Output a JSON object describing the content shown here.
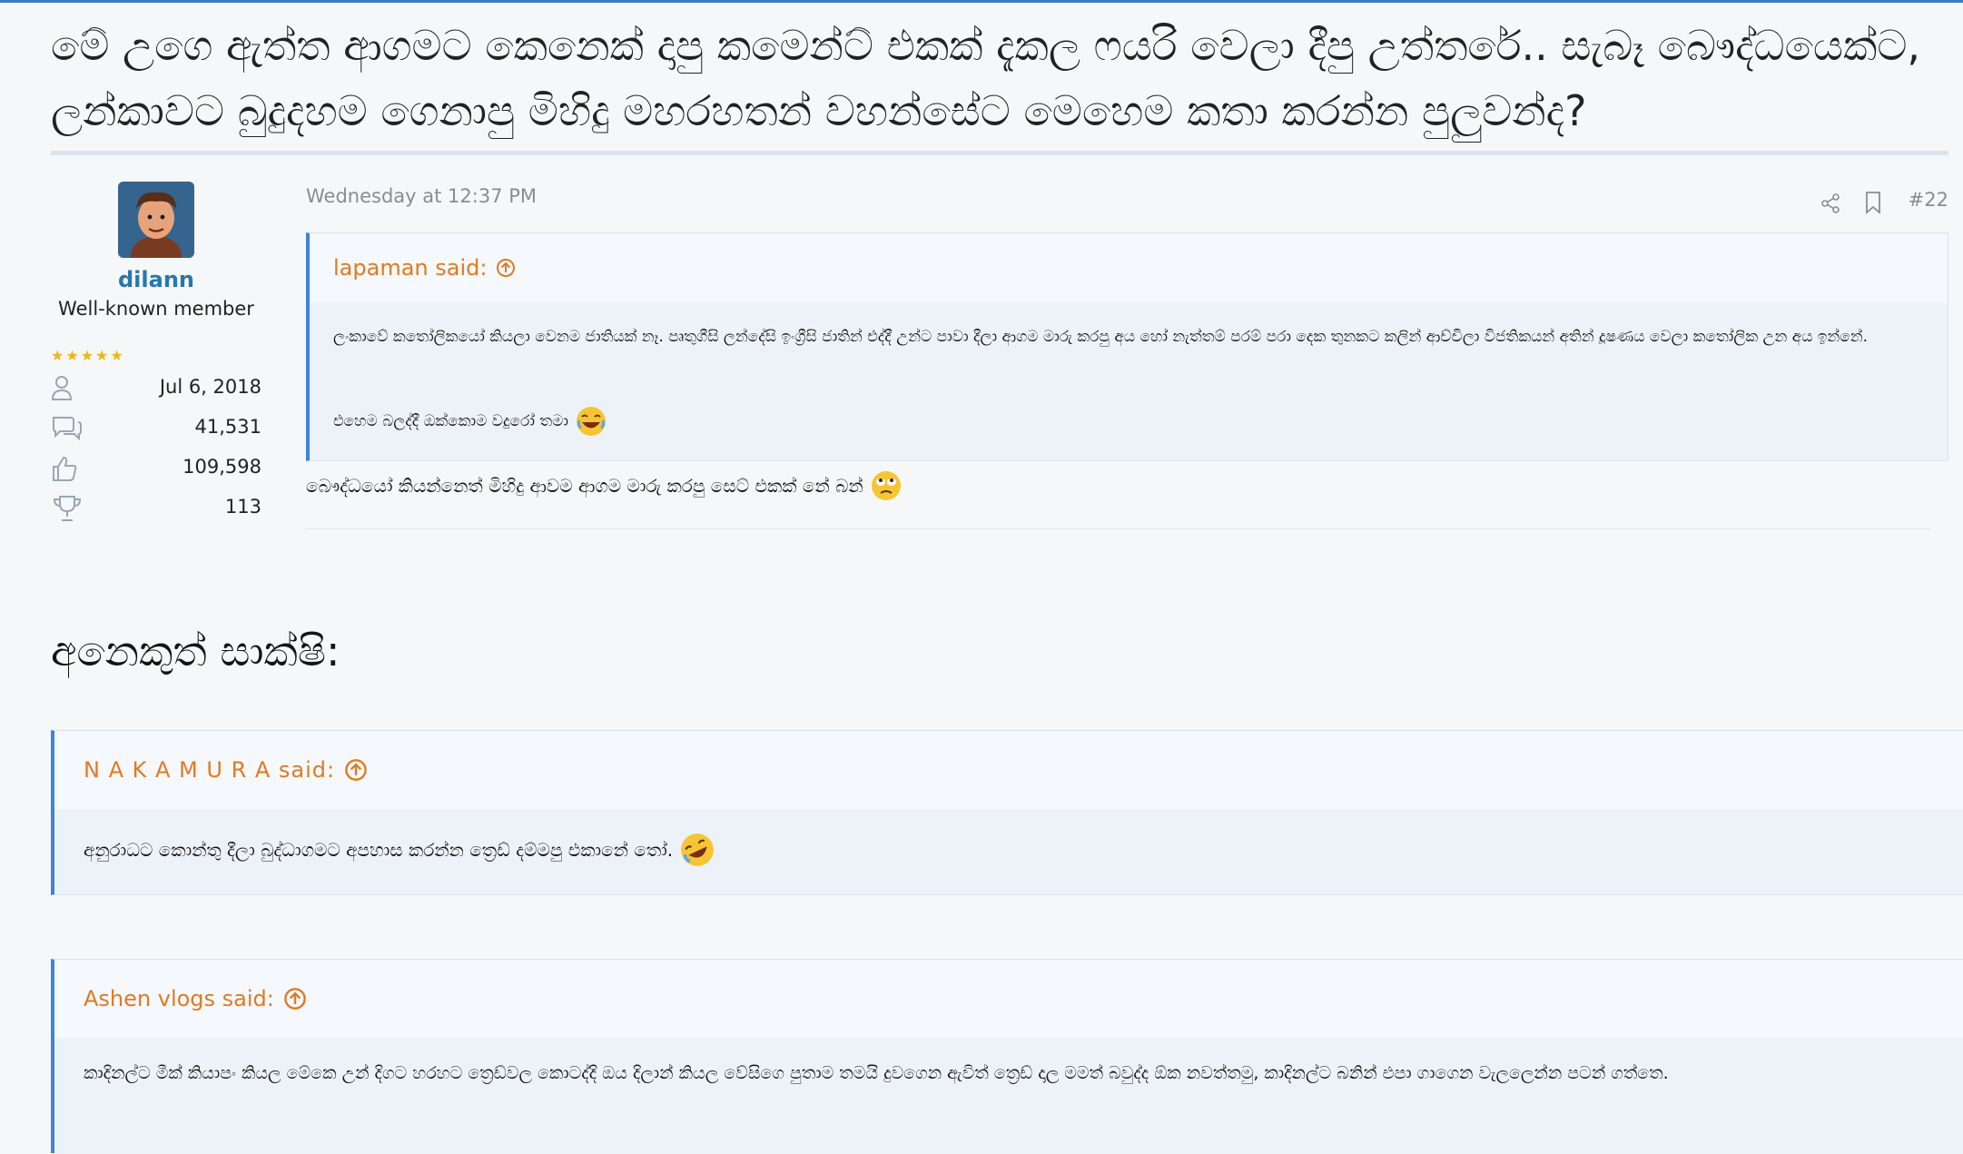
{
  "thread": {
    "title": "මේ උගෙ ඇත්ත ආගමට කෙනෙක් දාපු කමෙන්ට් එකක් දැකල ෆයරි වෙලා දීපු උත්තරේ.. සැබෑ බෞද්ධයෙක්ට, ලන්කාවට බුදුදහම ගෙනාපු මිහිදු මහරහතන් වහන්සේට මෙහෙම කතා කරන්න පුලුවන්ද?"
  },
  "post": {
    "user": {
      "name": "dilann",
      "title": "Well-known member",
      "stars": "★★★★★",
      "joined": "Jul 6, 2018",
      "messages": "41,531",
      "reactions": "109,598",
      "points": "113"
    },
    "timestamp": "Wednesday at 12:37 PM",
    "post_number": "#22",
    "quote": {
      "author": "lapaman said:",
      "body": "ලංකාවේ කතෝලිකයෝ කියලා වෙනම ජාතියක් නෑ. පෘතුගීසි ලන්දේසි ඉංග්‍රීසි ජාතින් එද්දී උන්ට පාවා දීලා ආගම මාරු කරපු අය හෝ නැත්තම් පරම් පරා දෙක තුනකට කලින් ආච්චිලා විජතිකයන් අතින් දූෂණය වෙලා කතෝලික උන අය ඉන්නේ.",
      "body2": "එහෙම බලද්දී ඔක්කොම වදුරෝ තමා"
    },
    "reply": "බෞද්ධයෝ කියන්නෙත් මිහිදු ආවම ආගම මාරු කරපු සෙට් එකක් නේ බන්"
  },
  "section": {
    "heading": "අනෙකුත් සාක්ෂි:"
  },
  "evidence": [
    {
      "author": "N A K A M U R A said:",
      "body": "අනුරාධට කොන්තු දීලා බුද්ධාගමට අපහාස කරන්න ත්‍රෙඩ් දම්මපු එකානේ තෝ."
    },
    {
      "author": "Ashen vlogs said:",
      "body": "කාදිනල්ට මීක් කියාපං කියල මේකෙ උන් දිගට හරහට ත්‍රෙඩ්වල කොටද්දි ඔය දිලාන් කියල වේසිගෙ පුතාම තමයි දුවගෙන ඇවිත් ත්‍රෙඩ් දාල මමත් බවුද්ද ඕක නවත්තමු, කාදිනල්ට බනින් එපා ගාගෙන වැලලෙන්න පටන් ගත්තෙ."
    }
  ],
  "colors": {
    "accent": "#3b86d8",
    "quote_author": "#e07a22",
    "username": "#2577b1"
  }
}
